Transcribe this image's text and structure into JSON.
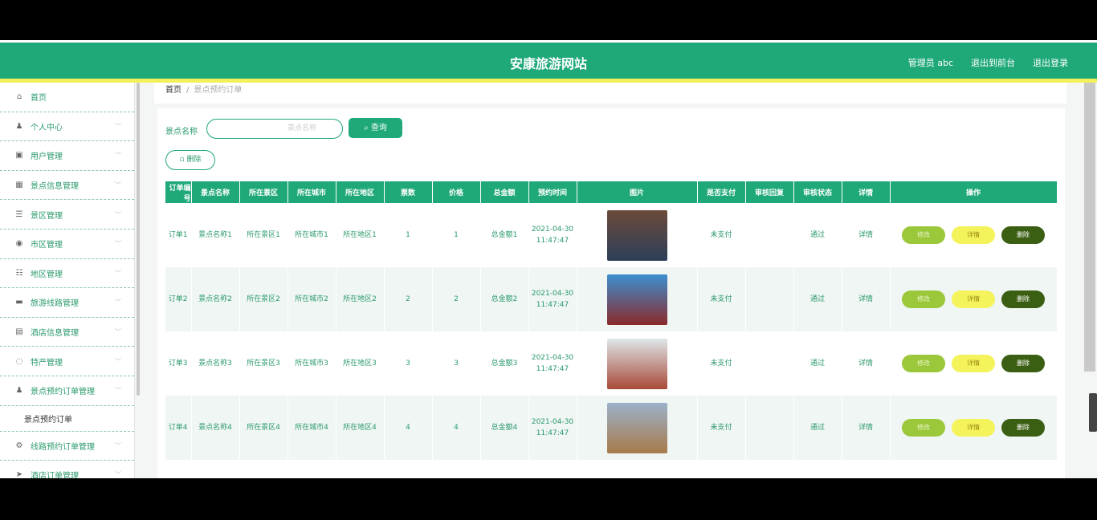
{
  "header": {
    "title": "安康旅游网站",
    "admin": "管理员 abc",
    "exit_backend": "退出到前台",
    "logout": "退出登录"
  },
  "sidebar": {
    "items": [
      {
        "label": "首页",
        "icon": "home-icon",
        "glyph": "⌂",
        "chevron": false
      },
      {
        "label": "个人中心",
        "icon": "user-icon",
        "glyph": "♟",
        "chevron": true
      },
      {
        "label": "用户管理",
        "icon": "users-icon",
        "glyph": "▣",
        "chevron": true
      },
      {
        "label": "景点信息管理",
        "icon": "building-icon",
        "glyph": "▦",
        "chevron": true
      },
      {
        "label": "景区管理",
        "icon": "list-icon",
        "glyph": "☰",
        "chevron": true
      },
      {
        "label": "市区管理",
        "icon": "city-icon",
        "glyph": "◉",
        "chevron": true
      },
      {
        "label": "地区管理",
        "icon": "map-icon",
        "glyph": "☷",
        "chevron": true
      },
      {
        "label": "旅游线路管理",
        "icon": "route-icon",
        "glyph": "▬",
        "chevron": true
      },
      {
        "label": "酒店信息管理",
        "icon": "hotel-icon",
        "glyph": "▤",
        "chevron": true
      },
      {
        "label": "特产管理",
        "icon": "gift-icon",
        "glyph": "◌",
        "chevron": true
      },
      {
        "label": "景点预约订单管理",
        "icon": "order-icon",
        "glyph": "♟",
        "chevron": true
      }
    ],
    "sub_item": "景点预约订单",
    "after_items": [
      {
        "label": "线路预约订单管理",
        "icon": "settings-icon",
        "glyph": "⚙",
        "chevron": true
      },
      {
        "label": "酒店订单管理",
        "icon": "send-icon",
        "glyph": "➤",
        "chevron": true
      }
    ]
  },
  "breadcrumb": {
    "home": "首页",
    "separator": "/",
    "current": "景点预约订单"
  },
  "search": {
    "label": "景点名称",
    "placeholder": "景点名称",
    "button": "查询",
    "delete_button": "删除"
  },
  "table": {
    "headers": [
      "订单编号",
      "景点名称",
      "所在景区",
      "所在城市",
      "所在地区",
      "票数",
      "价格",
      "总金额",
      "预约时间",
      "图片",
      "是否支付",
      "审核回复",
      "审核状态",
      "详情",
      "操作"
    ],
    "rows": [
      {
        "id": "订单1",
        "name": "景点名称1",
        "scenic": "所在景区1",
        "city": "所在城市1",
        "area": "所在地区1",
        "tickets": "1",
        "price": "1",
        "total": "总金额1",
        "time": "2021-04-30 11:47:47",
        "img_top": "#6b4a3a",
        "img_bottom": "#2d3f59",
        "paid": "未支付",
        "reply": "",
        "status": "通过",
        "detail": "详情"
      },
      {
        "id": "订单2",
        "name": "景点名称2",
        "scenic": "所在景区2",
        "city": "所在城市2",
        "area": "所在地区2",
        "tickets": "2",
        "price": "2",
        "total": "总金额2",
        "time": "2021-04-30 11:47:47",
        "img_top": "#3c8fd0",
        "img_bottom": "#8a2a2a",
        "paid": "未支付",
        "reply": "",
        "status": "通过",
        "detail": "详情"
      },
      {
        "id": "订单3",
        "name": "景点名称3",
        "scenic": "所在景区3",
        "city": "所在城市3",
        "area": "所在地区3",
        "tickets": "3",
        "price": "3",
        "total": "总金额3",
        "time": "2021-04-30 11:47:47",
        "img_top": "#dfe6ea",
        "img_bottom": "#a94a38",
        "paid": "未支付",
        "reply": "",
        "status": "通过",
        "detail": "详情"
      },
      {
        "id": "订单4",
        "name": "景点名称4",
        "scenic": "所在景区4",
        "city": "所在城市4",
        "area": "所在地区4",
        "tickets": "4",
        "price": "4",
        "total": "总金额4",
        "time": "2021-04-30 11:47:47",
        "img_top": "#9bb2c9",
        "img_bottom": "#a87a4a",
        "paid": "未支付",
        "reply": "",
        "status": "通过",
        "detail": "详情"
      }
    ],
    "actions": {
      "edit": "修改",
      "detail": "详情",
      "delete": "删除"
    }
  }
}
